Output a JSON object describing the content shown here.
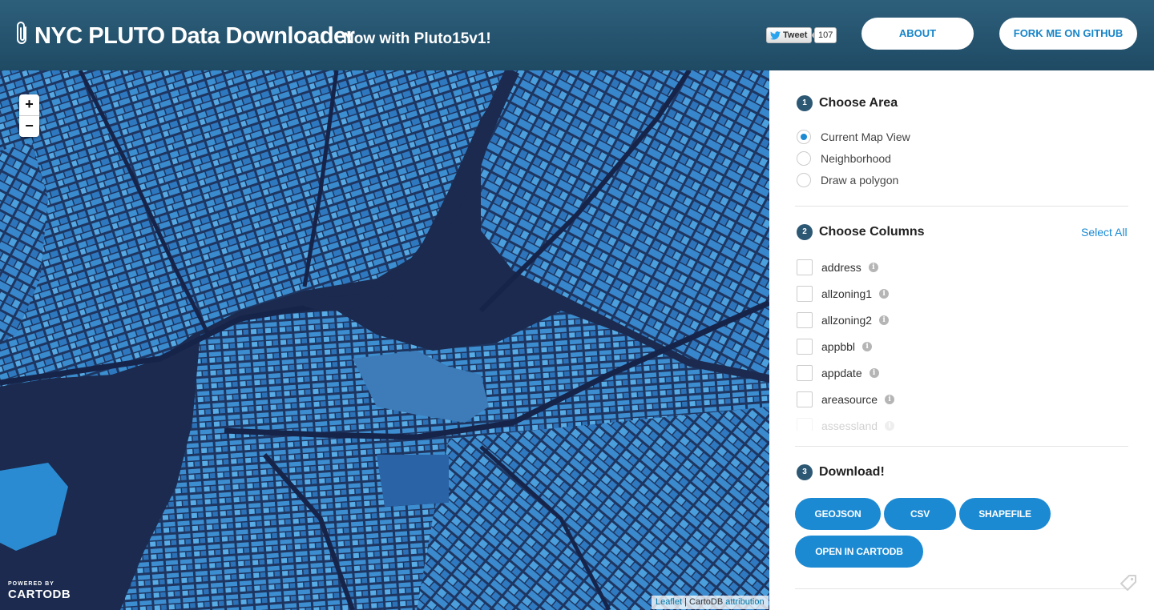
{
  "header": {
    "title": "NYC PLUTO Data Downloader",
    "subtitle": "Now with Pluto15v1!",
    "tweet_label": "Tweet",
    "tweet_count": "107",
    "about_label": "ABOUT",
    "github_label": "FORK ME ON GITHUB"
  },
  "map": {
    "zoom_in": "+",
    "zoom_out": "−",
    "powered_by": "POWERED BY",
    "cartodb_logo": "CARTODB",
    "attribution_leaflet": "Leaflet",
    "attribution_sep": " | CartoDB ",
    "attribution_link": "attribution"
  },
  "sidebar": {
    "step1": {
      "num": "1",
      "title": "Choose Area"
    },
    "area_options": [
      {
        "label": "Current Map View",
        "checked": true
      },
      {
        "label": "Neighborhood",
        "checked": false
      },
      {
        "label": "Draw a polygon",
        "checked": false
      }
    ],
    "step2": {
      "num": "2",
      "title": "Choose Columns"
    },
    "select_all": "Select All",
    "columns": [
      {
        "label": "address"
      },
      {
        "label": "allzoning1"
      },
      {
        "label": "allzoning2"
      },
      {
        "label": "appbbl"
      },
      {
        "label": "appdate"
      },
      {
        "label": "areasource"
      },
      {
        "label": "assessland"
      }
    ],
    "info_glyph": "i",
    "step3": {
      "num": "3",
      "title": "Download!"
    },
    "buttons": {
      "geojson": "GEOJSON",
      "csv": "CSV",
      "shapefile": "SHAPEFILE",
      "cartodb": "OPEN IN CARTODB"
    }
  },
  "colors": {
    "header_bg": "#2a5a76",
    "accent": "#1b8ad3",
    "map_water": "#1b2a4e",
    "map_land_light": "#4a9fd8",
    "map_land_dark": "#2b6db0"
  },
  "icons": [
    "paperclip-icon",
    "twitter-bird-icon",
    "info-icon",
    "tag-icon"
  ]
}
